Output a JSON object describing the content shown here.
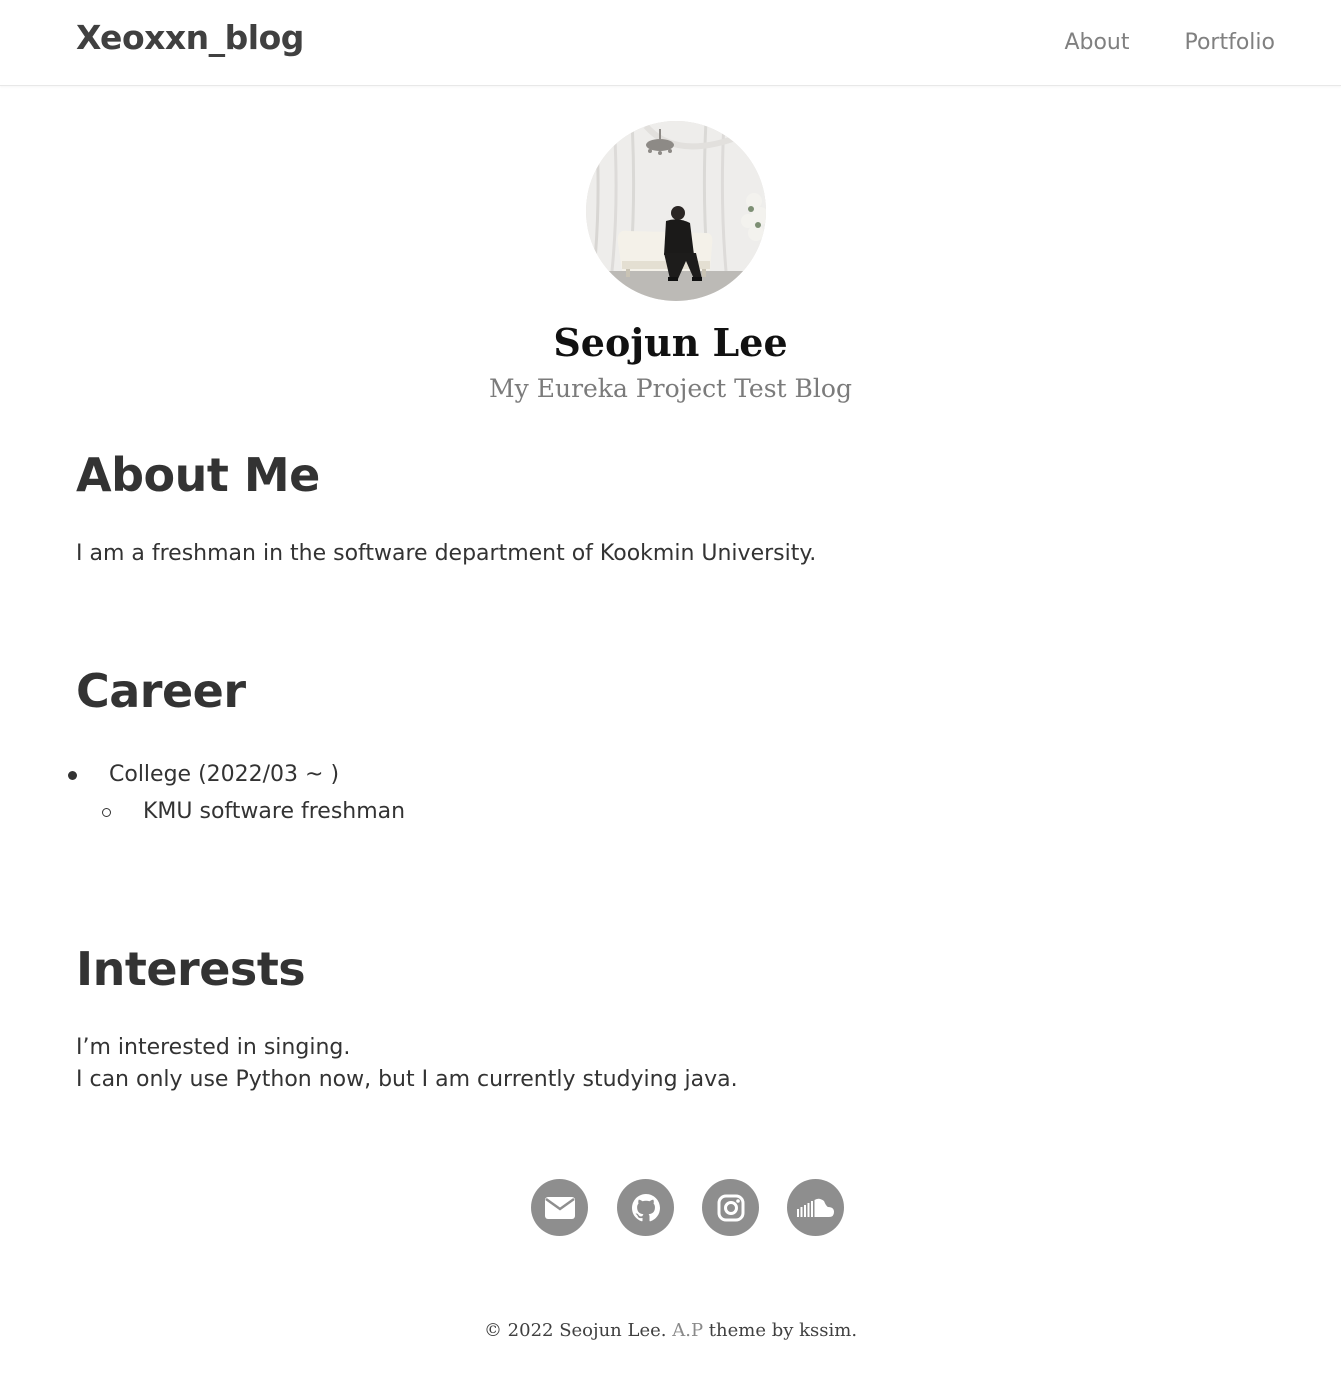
{
  "navbar": {
    "brand": "Xeoxxn_blog",
    "links": [
      "About",
      "Portfolio"
    ]
  },
  "profile": {
    "name": "Seojun Lee",
    "description": "My Eureka Project Test Blog"
  },
  "about": {
    "heading": "About Me",
    "text": "I am a freshman in the software department of Kookmin University."
  },
  "career": {
    "heading": "Career",
    "items": [
      {
        "label": "College (2022/03 ~ )",
        "sub": [
          "KMU software freshman"
        ]
      }
    ]
  },
  "interests": {
    "heading": "Interests",
    "lines": [
      "I’m interested in singing.",
      "I can only use Python now, but I am currently studying java."
    ]
  },
  "social": {
    "icons": [
      "email-icon",
      "github-icon",
      "instagram-icon",
      "soundcloud-icon"
    ],
    "color": "#8e8e8e"
  },
  "footer": {
    "copyright": "© 2022 Seojun Lee.",
    "theme_name": "A.P",
    "theme_suffix": "theme by kssim."
  }
}
